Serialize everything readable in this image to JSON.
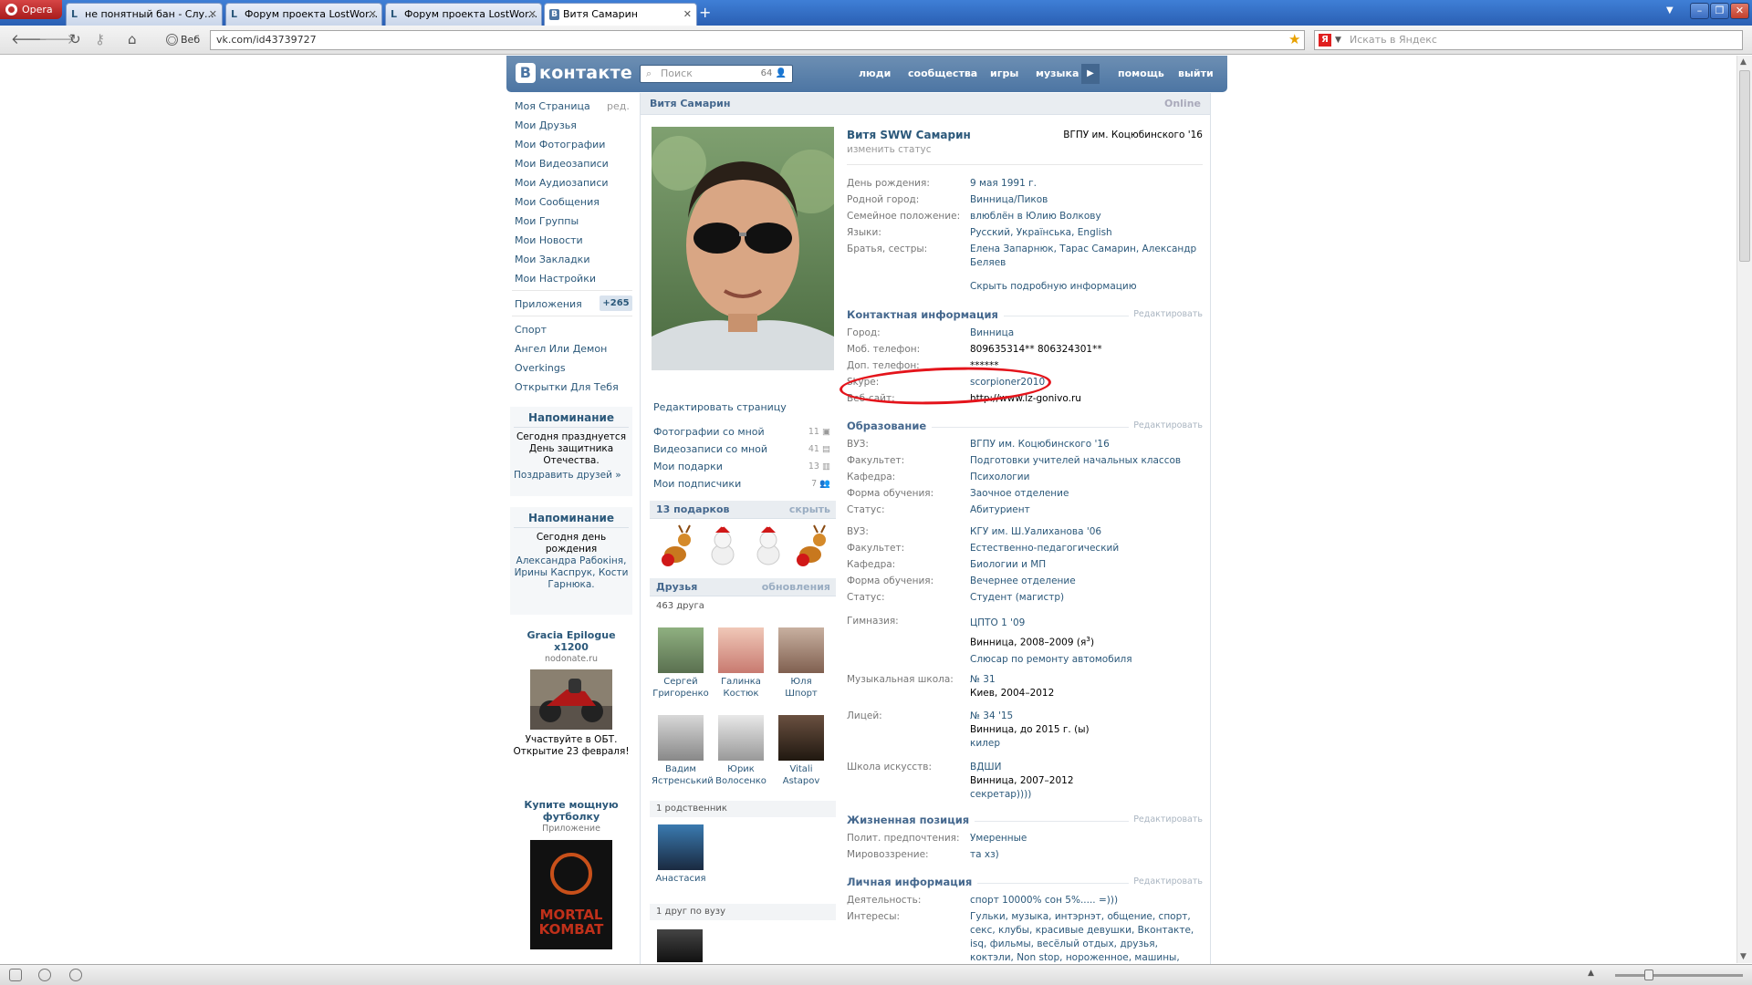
{
  "browser": {
    "app_label": "Opera",
    "tabs": [
      {
        "label": "не понятный бан - Слу..."
      },
      {
        "label": "Форум проекта LostWor..."
      },
      {
        "label": "Форум проекта LostWor..."
      },
      {
        "label": "Витя Самарин"
      }
    ],
    "web_label": "Веб",
    "url": "vk.com/id43739727",
    "search_placeholder": "Искать в Яндекс"
  },
  "header": {
    "logo": "контакте",
    "search_placeholder": "Поиск",
    "search_count": "64",
    "menu": [
      "люди",
      "сообщества",
      "игры",
      "музыка",
      "помощь",
      "выйти"
    ]
  },
  "left_menu": {
    "items": [
      "Моя Страница",
      "Мои Друзья",
      "Мои Фотографии",
      "Мои Видеозаписи",
      "Мои Аудиозаписи",
      "Мои Сообщения",
      "Мои Группы",
      "Мои Новости",
      "Мои Закладки",
      "Мои Настройки"
    ],
    "edit": "ред.",
    "apps_label": "Приложения",
    "apps_count": "+265",
    "app_items": [
      "Спорт",
      "Ангел Или Демон",
      "Overkings",
      "Открытки Для Тебя"
    ],
    "reminder1": {
      "title": "Напоминание",
      "text": "Сегодня празднуется День защитника Отечества.",
      "link": "Поздравить друзей »"
    },
    "reminder2": {
      "title": "Напоминание",
      "text_a": "Сегодня",
      "text_b": "день рождения",
      "names": "Александра Рабокіня, Ирины Каспрук, Кости Гарнюка."
    },
    "ad1": {
      "title": "Gracia Epilogue x1200",
      "site": "nodonate.ru",
      "text": "Участвуйте в ОБТ. Открытие 23 февраля!"
    },
    "ad2": {
      "title": "Купите мощную футболку",
      "sub": "Приложение",
      "image_text": "MORTAL KOMBAT"
    }
  },
  "page": {
    "title": "Витя Самарин",
    "online": "Online",
    "edit_page": "Редактировать страницу",
    "links": [
      {
        "label": "Фотографии со мной",
        "count": "11"
      },
      {
        "label": "Видеозаписи со мной",
        "count": "41"
      },
      {
        "label": "Мои подарки",
        "count": "13"
      },
      {
        "label": "Мои подписчики",
        "count": "7"
      }
    ],
    "gifts_title": "13 подарков",
    "gifts_hide": "скрыть",
    "friends_title": "Друзья",
    "friends_updates": "обновления",
    "friends_count": "463 друга",
    "friends": [
      {
        "first": "Сергей",
        "last": "Григоренко"
      },
      {
        "first": "Галинка",
        "last": "Костюк"
      },
      {
        "first": "Юля",
        "last": "Шпорт"
      },
      {
        "first": "Вадим",
        "last": "Ястренський"
      },
      {
        "first": "Юрик",
        "last": "Волосенко"
      },
      {
        "first": "Vitali",
        "last": "Astapov"
      }
    ],
    "relatives_label": "1 родственник",
    "relative_name": "Анастасия",
    "univ_friend_label": "1 друг по вузу"
  },
  "profile": {
    "fullname": "Витя SWW Самарин",
    "univ_top": "ВГПУ им. Коцюбинского '16",
    "status": "изменить статус",
    "basic": [
      {
        "k": "День рождения:",
        "v": "9 мая 1991 г."
      },
      {
        "k": "Родной город:",
        "v": "Винница/Пиков"
      },
      {
        "k": "Семейное положение:",
        "v": "влюблён в Юлию Волкову"
      },
      {
        "k": "Языки:",
        "v": "Русский, Українська, English"
      },
      {
        "k": "Братья, сестры:",
        "v": "Елена Запарнюк, Тарас Самарин, Александр Беляев"
      }
    ],
    "hide_details": "Скрыть подробную информацию",
    "edit_label": "Редактировать",
    "contact_title": "Контактная информация",
    "contact": [
      {
        "k": "Город:",
        "v": "Винница"
      },
      {
        "k": "Моб. телефон:",
        "v": "809635314** 806324301**"
      },
      {
        "k": "Доп. телефон:",
        "v": "******"
      },
      {
        "k": "Skype:",
        "v": "scorpioner2010"
      },
      {
        "k": "Веб-сайт:",
        "v": "http://www.lz-gonivo.ru"
      }
    ],
    "edu_title": "Образование",
    "edu1": [
      {
        "k": "ВУЗ:",
        "v": "ВГПУ им. Коцюбинского '16"
      },
      {
        "k": "Факультет:",
        "v": "Подготовки учителей начальных классов"
      },
      {
        "k": "Кафедра:",
        "v": "Психологии"
      },
      {
        "k": "Форма обучения:",
        "v": "Заочное отделение"
      },
      {
        "k": "Статус:",
        "v": "Абитуриент"
      }
    ],
    "edu2": [
      {
        "k": "ВУЗ:",
        "v": "КГУ им. Ш.Уалиханова '06"
      },
      {
        "k": "Факультет:",
        "v": "Естественно-педагогический"
      },
      {
        "k": "Кафедра:",
        "v": "Биологии и МП"
      },
      {
        "k": "Форма обучения:",
        "v": "Вечернее отделение"
      },
      {
        "k": "Статус:",
        "v": "Студент (магистр)"
      }
    ],
    "school": {
      "gym_k": "Гимназия:",
      "gym_name": "ЦПТО 1 '09",
      "gym_place": "Винница, 2008–2009 (я",
      "gym_sup": "з",
      "gym_close": ")",
      "gym_spec": "Слюсар по ремонту автомобиля",
      "music_k": "Музыкальная школа:",
      "music_name": "№ 31",
      "music_place": "Киев, 2004–2012",
      "lyc_k": "Лицей:",
      "lyc_name": "№ 34 '15",
      "lyc_place": "Винница, до 2015 г. (ы)",
      "lyc_spec": "килер",
      "art_k": "Школа искусств:",
      "art_name": "ВДШИ",
      "art_place": "Винница, 2007–2012",
      "art_spec": "секретар))))"
    },
    "life_title": "Жизненная позиция",
    "life": [
      {
        "k": "Полит. предпочтения:",
        "v": "Умеренные"
      },
      {
        "k": "Мировоззрение:",
        "v": "та хз)"
      }
    ],
    "personal_title": "Личная информация",
    "personal": [
      {
        "k": "Деятельность:",
        "v": "спорт 10000% сон 5%..... =)))"
      },
      {
        "k": "Интересы:",
        "v": "Гульки, музыка, интэрнэт, общение, спорт, секс, клубы, красивые девушки, Вконтакте, isq, фильмы, весёлый отдых, друзья, коктэли, Non stop, нороженное, машины, дождь, природа,"
      }
    ]
  },
  "colors": {
    "vk_blue": "#4c75a3",
    "link": "#2b587a",
    "annotation_red": "#e4141b"
  }
}
